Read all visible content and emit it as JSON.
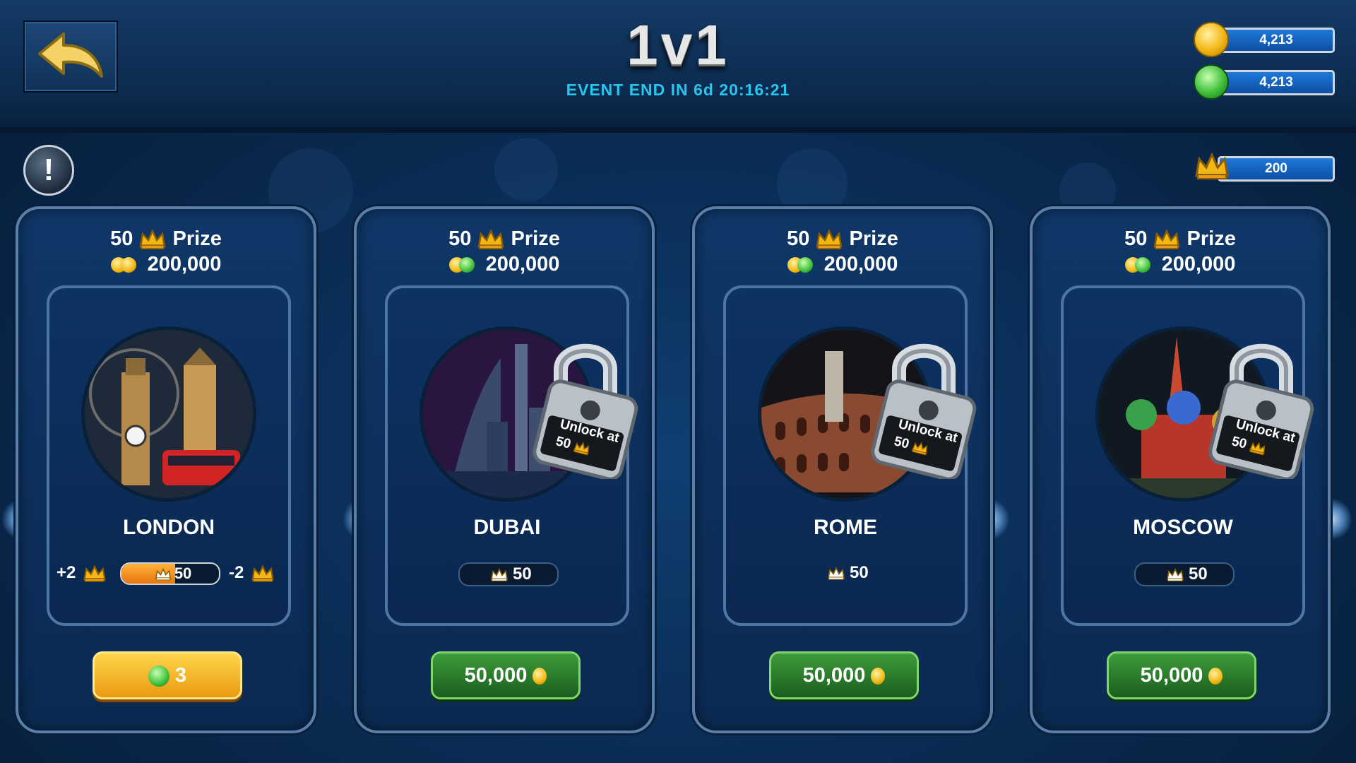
{
  "header": {
    "title": "1v1",
    "event_end": "EVENT END IN 6d 20:16:21"
  },
  "currencies": {
    "coins": "4,213",
    "gems": "4,213",
    "crowns": "200"
  },
  "cards": [
    {
      "prize_crowns": "50",
      "prize_label": "Prize",
      "prize_amount": "200,000",
      "city": "LONDON",
      "locked": false,
      "crown_plus": "+2",
      "crown_value": "50",
      "crown_minus": "-2",
      "progress": 0.55,
      "button": "3",
      "button_type": "gem"
    },
    {
      "prize_crowns": "50",
      "prize_label": "Prize",
      "prize_amount": "200,000",
      "city": "DUBAI",
      "locked": true,
      "lock_text": "Unlock at",
      "lock_value": "50",
      "crown_value": "50",
      "button": "50,000",
      "button_type": "coin"
    },
    {
      "prize_crowns": "50",
      "prize_label": "Prize",
      "prize_amount": "200,000",
      "city": "ROME",
      "locked": true,
      "lock_text": "Unlock at",
      "lock_value": "50",
      "crown_value": "50",
      "button": "50,000",
      "button_type": "coin"
    },
    {
      "prize_crowns": "50",
      "prize_label": "Prize",
      "prize_amount": "200,000",
      "city": "MOSCOW",
      "locked": true,
      "lock_text": "Unlock at",
      "lock_value": "50",
      "crown_value": "50",
      "button": "50,000",
      "button_type": "coin"
    }
  ],
  "icons": {
    "back": "back-arrow-icon",
    "info": "exclamation-icon",
    "coin": "coin-icon",
    "gem": "gem-icon",
    "crown": "crown-icon",
    "lock": "padlock-icon"
  },
  "colors": {
    "accent": "#27c6ee",
    "background": "#0a2d55",
    "green_button": "#2f8a2e",
    "gold_button": "#f2b615"
  }
}
